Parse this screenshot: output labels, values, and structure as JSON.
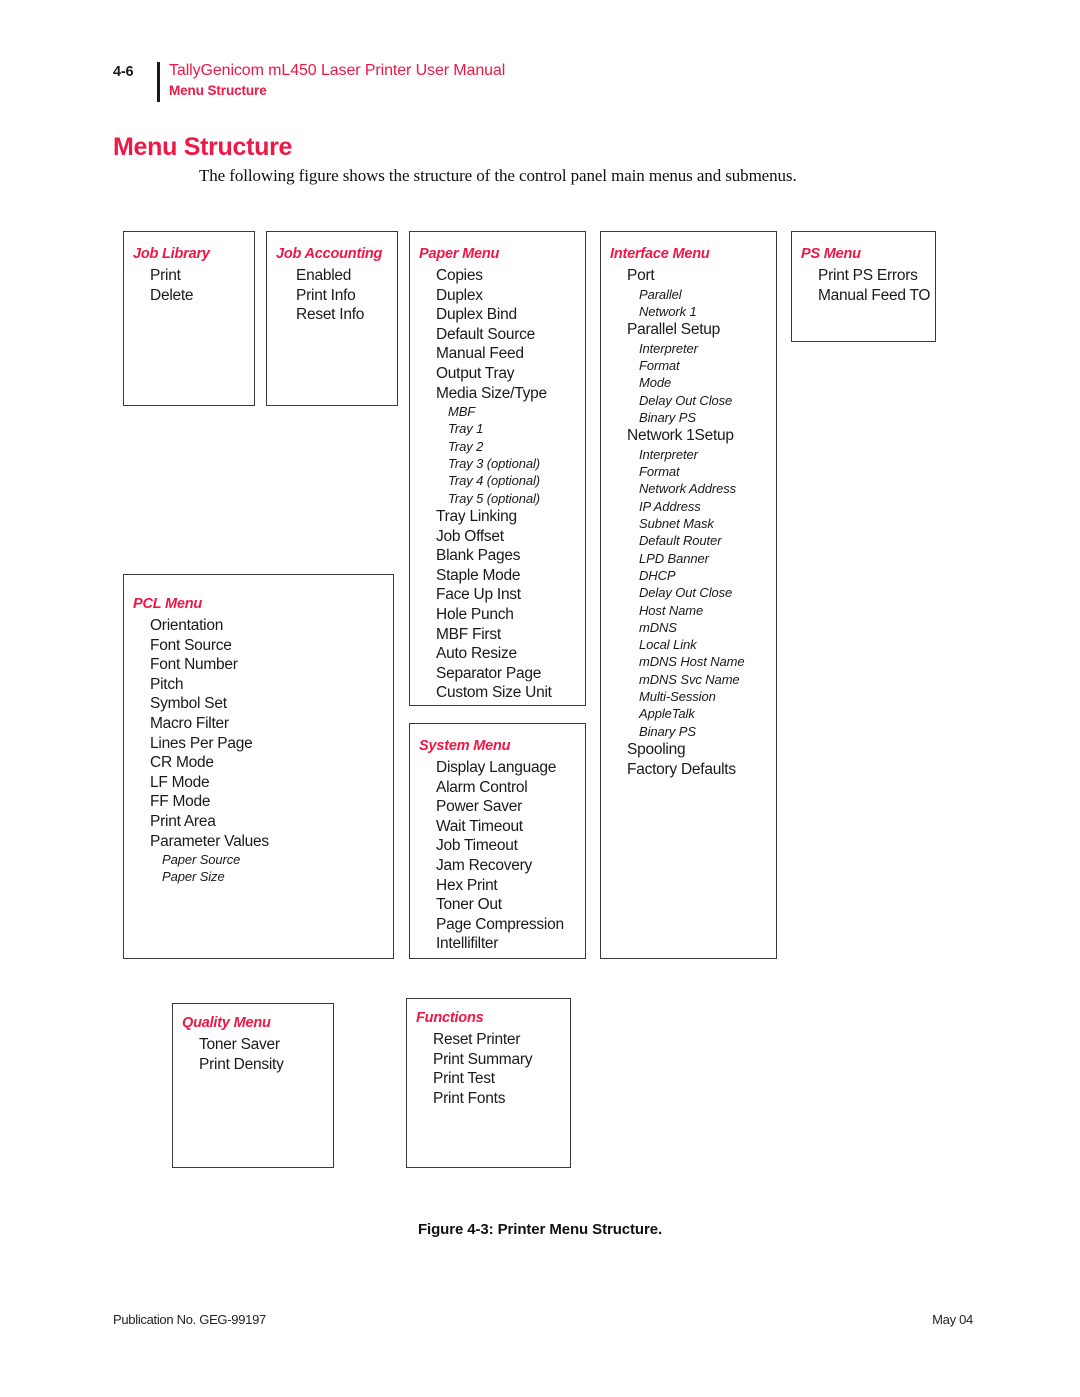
{
  "header": {
    "page_number": "4-6",
    "manual_title": "TallyGenicom mL450 Laser Printer User Manual",
    "section": "Menu Structure"
  },
  "section_title": "Menu Structure",
  "intro_text": "The following figure shows the structure of the control panel main menus and submenus.",
  "figure_caption": "Figure 4-3:  Printer Menu Structure.",
  "footer": {
    "publication": "Publication No. GEG-99197",
    "date": "May 04"
  },
  "colors": {
    "accent_red": "#ED1846",
    "box_border": "#3a3a3a",
    "body_text": "#1a1a1a"
  },
  "boxes": [
    {
      "id": "job-library",
      "title": "Job Library",
      "items": [
        {
          "label": "Print",
          "level": 1
        },
        {
          "label": "Delete",
          "level": 1
        }
      ]
    },
    {
      "id": "job-accounting",
      "title": "Job Accounting",
      "items": [
        {
          "label": "Enabled",
          "level": 1
        },
        {
          "label": "Print Info",
          "level": 1
        },
        {
          "label": "Reset Info",
          "level": 1
        }
      ]
    },
    {
      "id": "paper-menu",
      "title": "Paper Menu",
      "items": [
        {
          "label": "Copies",
          "level": 1
        },
        {
          "label": "Duplex",
          "level": 1
        },
        {
          "label": "Duplex Bind",
          "level": 1
        },
        {
          "label": "Default Source",
          "level": 1
        },
        {
          "label": "Manual Feed",
          "level": 1
        },
        {
          "label": "Output Tray",
          "level": 1
        },
        {
          "label": "Media Size/Type",
          "level": 1
        },
        {
          "label": "MBF",
          "level": 2
        },
        {
          "label": "Tray 1",
          "level": 2
        },
        {
          "label": "Tray 2",
          "level": 2
        },
        {
          "label": "Tray 3 (optional)",
          "level": 2
        },
        {
          "label": "Tray 4 (optional)",
          "level": 2
        },
        {
          "label": "Tray 5 (optional)",
          "level": 2
        },
        {
          "label": "Tray Linking",
          "level": 1
        },
        {
          "label": "Job Offset",
          "level": 1
        },
        {
          "label": "Blank Pages",
          "level": 1
        },
        {
          "label": "Staple Mode",
          "level": 1
        },
        {
          "label": "Face Up Inst",
          "level": 1
        },
        {
          "label": "Hole Punch",
          "level": 1
        },
        {
          "label": "MBF First",
          "level": 1
        },
        {
          "label": "Auto Resize",
          "level": 1
        },
        {
          "label": "Separator Page",
          "level": 1
        },
        {
          "label": "Custom Size Unit",
          "level": 1
        }
      ]
    },
    {
      "id": "interface-menu",
      "title": "Interface Menu",
      "items": [
        {
          "label": "Port",
          "level": 1
        },
        {
          "label": "Parallel",
          "level": 2
        },
        {
          "label": "Network 1",
          "level": 2
        },
        {
          "label": "Parallel Setup",
          "level": 1
        },
        {
          "label": "Interpreter",
          "level": 2
        },
        {
          "label": "Format",
          "level": 2
        },
        {
          "label": "Mode",
          "level": 2
        },
        {
          "label": "Delay Out Close",
          "level": 2
        },
        {
          "label": "Binary PS",
          "level": 2
        },
        {
          "label": "Network 1Setup",
          "level": 1
        },
        {
          "label": "Interpreter",
          "level": 2
        },
        {
          "label": "Format",
          "level": 2
        },
        {
          "label": "Network Address",
          "level": 2
        },
        {
          "label": "IP Address",
          "level": 2
        },
        {
          "label": "Subnet Mask",
          "level": 2
        },
        {
          "label": "Default Router",
          "level": 2
        },
        {
          "label": "LPD Banner",
          "level": 2
        },
        {
          "label": "DHCP",
          "level": 2
        },
        {
          "label": "Delay Out Close",
          "level": 2
        },
        {
          "label": "Host Name",
          "level": 2
        },
        {
          "label": "mDNS",
          "level": 2
        },
        {
          "label": "Local Link",
          "level": 2
        },
        {
          "label": "mDNS Host Name",
          "level": 2
        },
        {
          "label": "mDNS Svc Name",
          "level": 2
        },
        {
          "label": "Multi-Session",
          "level": 2
        },
        {
          "label": "AppleTalk",
          "level": 2
        },
        {
          "label": "Binary PS",
          "level": 2
        },
        {
          "label": "Spooling",
          "level": 1
        },
        {
          "label": "Factory Defaults",
          "level": 1
        }
      ]
    },
    {
      "id": "ps-menu",
      "title": "PS Menu",
      "items": [
        {
          "label": "Print PS Errors",
          "level": 1
        },
        {
          "label": "Manual Feed TO",
          "level": 1
        }
      ]
    },
    {
      "id": "pcl-menu",
      "title": "PCL Menu",
      "items": [
        {
          "label": "Orientation",
          "level": 1
        },
        {
          "label": "Font Source",
          "level": 1
        },
        {
          "label": "Font Number",
          "level": 1
        },
        {
          "label": "Pitch",
          "level": 1
        },
        {
          "label": "Symbol Set",
          "level": 1
        },
        {
          "label": "Macro Filter",
          "level": 1
        },
        {
          "label": "Lines Per Page",
          "level": 1
        },
        {
          "label": "CR Mode",
          "level": 1
        },
        {
          "label": "LF Mode",
          "level": 1
        },
        {
          "label": "FF Mode",
          "level": 1
        },
        {
          "label": "Print Area",
          "level": 1
        },
        {
          "label": "Parameter Values",
          "level": 1
        },
        {
          "label": "Paper Source",
          "level": 2
        },
        {
          "label": "Paper Size",
          "level": 2
        }
      ]
    },
    {
      "id": "system-menu",
      "title": "System Menu",
      "items": [
        {
          "label": "Display Language",
          "level": 1
        },
        {
          "label": "Alarm Control",
          "level": 1
        },
        {
          "label": "Power Saver",
          "level": 1
        },
        {
          "label": "Wait Timeout",
          "level": 1
        },
        {
          "label": "Job Timeout",
          "level": 1
        },
        {
          "label": "Jam Recovery",
          "level": 1
        },
        {
          "label": "Hex Print",
          "level": 1
        },
        {
          "label": "Toner Out",
          "level": 1
        },
        {
          "label": "Page Compression",
          "level": 1
        },
        {
          "label": "Intellifilter",
          "level": 1
        }
      ]
    },
    {
      "id": "quality-menu",
      "title": "Quality Menu",
      "items": [
        {
          "label": "Toner Saver",
          "level": 1
        },
        {
          "label": "Print Density",
          "level": 1
        }
      ]
    },
    {
      "id": "functions",
      "title": "Functions",
      "items": [
        {
          "label": "Reset Printer",
          "level": 1
        },
        {
          "label": "Print Summary",
          "level": 1
        },
        {
          "label": "Print Test",
          "level": 1
        },
        {
          "label": "Print Fonts",
          "level": 1
        }
      ]
    }
  ]
}
